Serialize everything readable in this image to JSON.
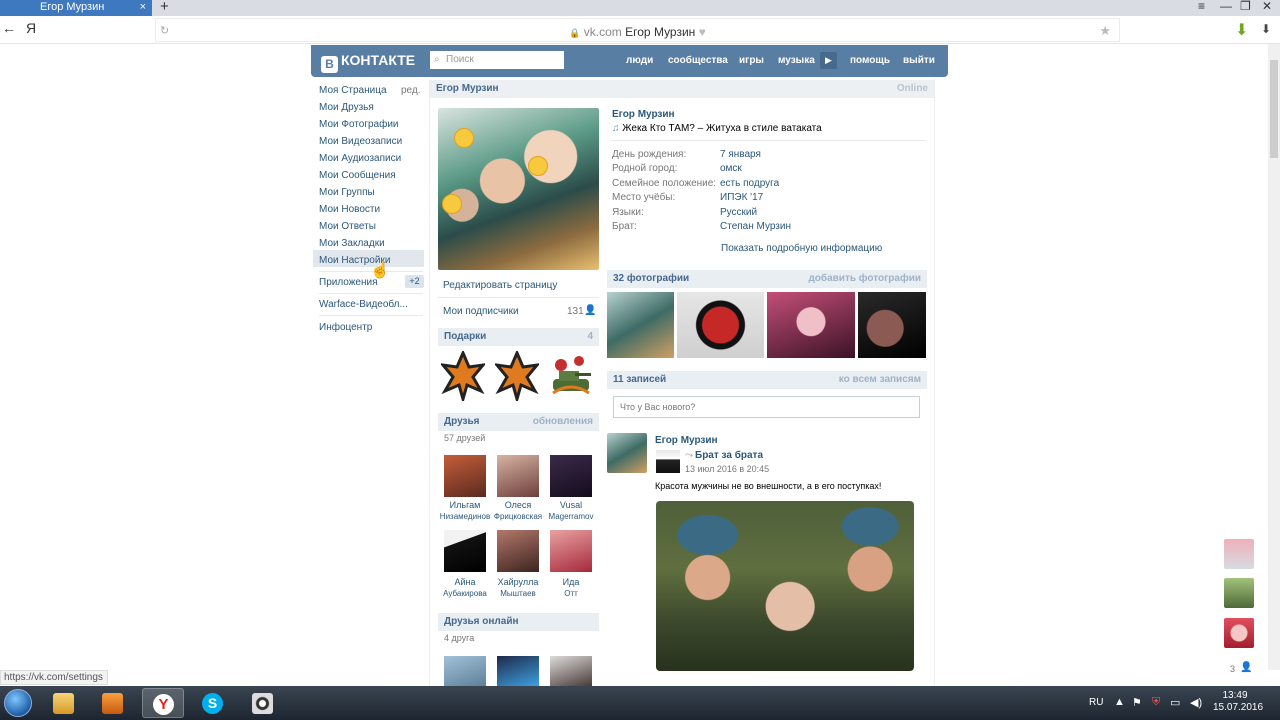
{
  "browser": {
    "tab_title": "Егор Мурзин",
    "tab_close": "×",
    "new_tab": "+",
    "url_domain": "vk.com",
    "url_title": "Егор Мурзин",
    "back_icon": "←",
    "yandex_logo": "Я",
    "reload_icon": "↻",
    "bookmark_icon": "★",
    "lock_icon": "🔒",
    "heart_icon": "♥",
    "win_min": "—",
    "win_max": "❐",
    "win_close": "✕",
    "menu_icon": "≡",
    "download_icon": "⬇",
    "status_url": "https://vk.com/settings"
  },
  "vk_header": {
    "logo_text": "КОНТАКТЕ",
    "logo_letter": "В",
    "search_placeholder": "Поиск",
    "nav": [
      "люди",
      "сообщества",
      "игры",
      "музыка",
      "помощь",
      "выйти"
    ]
  },
  "left_menu": {
    "items": [
      "Моя Страница",
      "Мои Друзья",
      "Мои Фотографии",
      "Мои Видеозаписи",
      "Мои Аудиозаписи",
      "Мои Сообщения",
      "Мои Группы",
      "Мои Новости",
      "Мои Ответы",
      "Мои Закладки",
      "Мои Настройки"
    ],
    "edit": "ред.",
    "apps": "Приложения",
    "apps_badge": "+2",
    "warface": "Warface-Видеобл...",
    "info": "Инфоцентр"
  },
  "profile": {
    "head_name": "Егор Мурзин",
    "online": "Online",
    "name": "Егор Мурзин",
    "status": "Жека Кто ТАМ? – Житуха в стиле ватаката",
    "info": [
      {
        "label": "День рождения:",
        "value": "7 января"
      },
      {
        "label": "Родной город:",
        "value": "омск"
      },
      {
        "label": "Семейное положение:",
        "value": "есть подруга"
      },
      {
        "label": "Место учёбы:",
        "value": "ИПЭК '17"
      },
      {
        "label": "Языки:",
        "value": "Русский"
      },
      {
        "label": "Брат:",
        "value": "Степан Мурзин"
      }
    ],
    "show_more": "Показать подробную информацию",
    "edit_page": "Редактировать страницу",
    "subscribers": "Мои подписчики",
    "subscribers_count": "131"
  },
  "gifts": {
    "title": "Подарки",
    "count": "4"
  },
  "friends": {
    "title": "Друзья",
    "updates": "обновления",
    "count_text": "57 друзей",
    "list": [
      {
        "first": "Ильгам",
        "last": "Низамединов"
      },
      {
        "first": "Олеся",
        "last": "Фрицковская"
      },
      {
        "first": "Vusal",
        "last": "Magerramov"
      },
      {
        "first": "Айна",
        "last": "Аубакирова"
      },
      {
        "first": "Хайрулла",
        "last": "Мыштаев"
      },
      {
        "first": "Ида",
        "last": "Отт"
      }
    ],
    "online_title": "Друзья онлайн",
    "online_count": "4 друга"
  },
  "photos": {
    "title": "32 фотографии",
    "add": "добавить фотографии"
  },
  "wall": {
    "title": "11 записей",
    "all": "ко всем записям",
    "placeholder": "Что у Вас нового?",
    "post": {
      "author": "Егор Мурзин",
      "repost_from": "Брат за брата",
      "date": "13 июл 2016 в 20:45",
      "text": "Красота мужчины не во внешности, а в его поступках!"
    }
  },
  "side": {
    "count": "3"
  },
  "taskbar": {
    "lang": "RU",
    "time": "13:49",
    "date": "15.07.2016"
  }
}
